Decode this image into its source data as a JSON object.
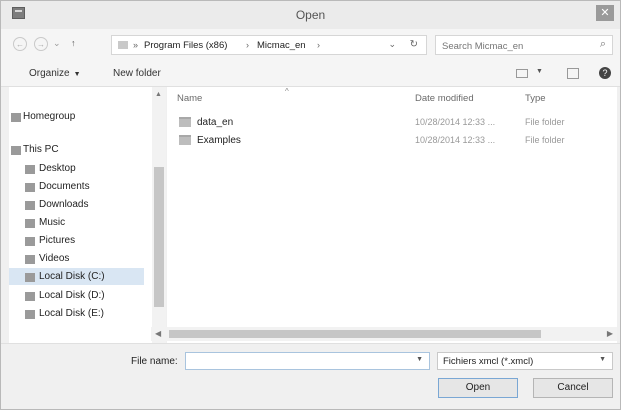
{
  "window": {
    "title": "Open"
  },
  "nav": {
    "back_icon": "back-arrow-icon",
    "forward_icon": "forward-arrow-icon",
    "up_icon": "up-arrow-icon",
    "address": {
      "crumb1": "Program Files (x86)",
      "crumb2": "Micmac_en"
    },
    "search_placeholder": "Search Micmac_en"
  },
  "toolbar": {
    "organize": "Organize",
    "new_folder": "New folder"
  },
  "sidebar": {
    "items": [
      {
        "label": "Homegroup"
      },
      {
        "label": "This PC"
      },
      {
        "label": "Desktop"
      },
      {
        "label": "Documents"
      },
      {
        "label": "Downloads"
      },
      {
        "label": "Music"
      },
      {
        "label": "Pictures"
      },
      {
        "label": "Videos"
      },
      {
        "label": "Local Disk (C:)"
      },
      {
        "label": "Local Disk (D:)"
      },
      {
        "label": "Local Disk (E:)"
      }
    ],
    "selected_index": 8
  },
  "list": {
    "columns": {
      "name": "Name",
      "date": "Date modified",
      "type": "Type"
    },
    "rows": [
      {
        "name": "data_en",
        "date": "10/28/2014 12:33 ...",
        "type": "File folder"
      },
      {
        "name": "Examples",
        "date": "10/28/2014 12:33 ...",
        "type": "File folder"
      }
    ]
  },
  "footer": {
    "file_name_label": "File name:",
    "file_name_value": "",
    "filter_value": "Fichiers xmcl (*.xmcl)",
    "open_label": "Open",
    "cancel_label": "Cancel"
  },
  "colors": {
    "selection": "#d9e6f3",
    "accent_border": "#7aa7d4"
  }
}
